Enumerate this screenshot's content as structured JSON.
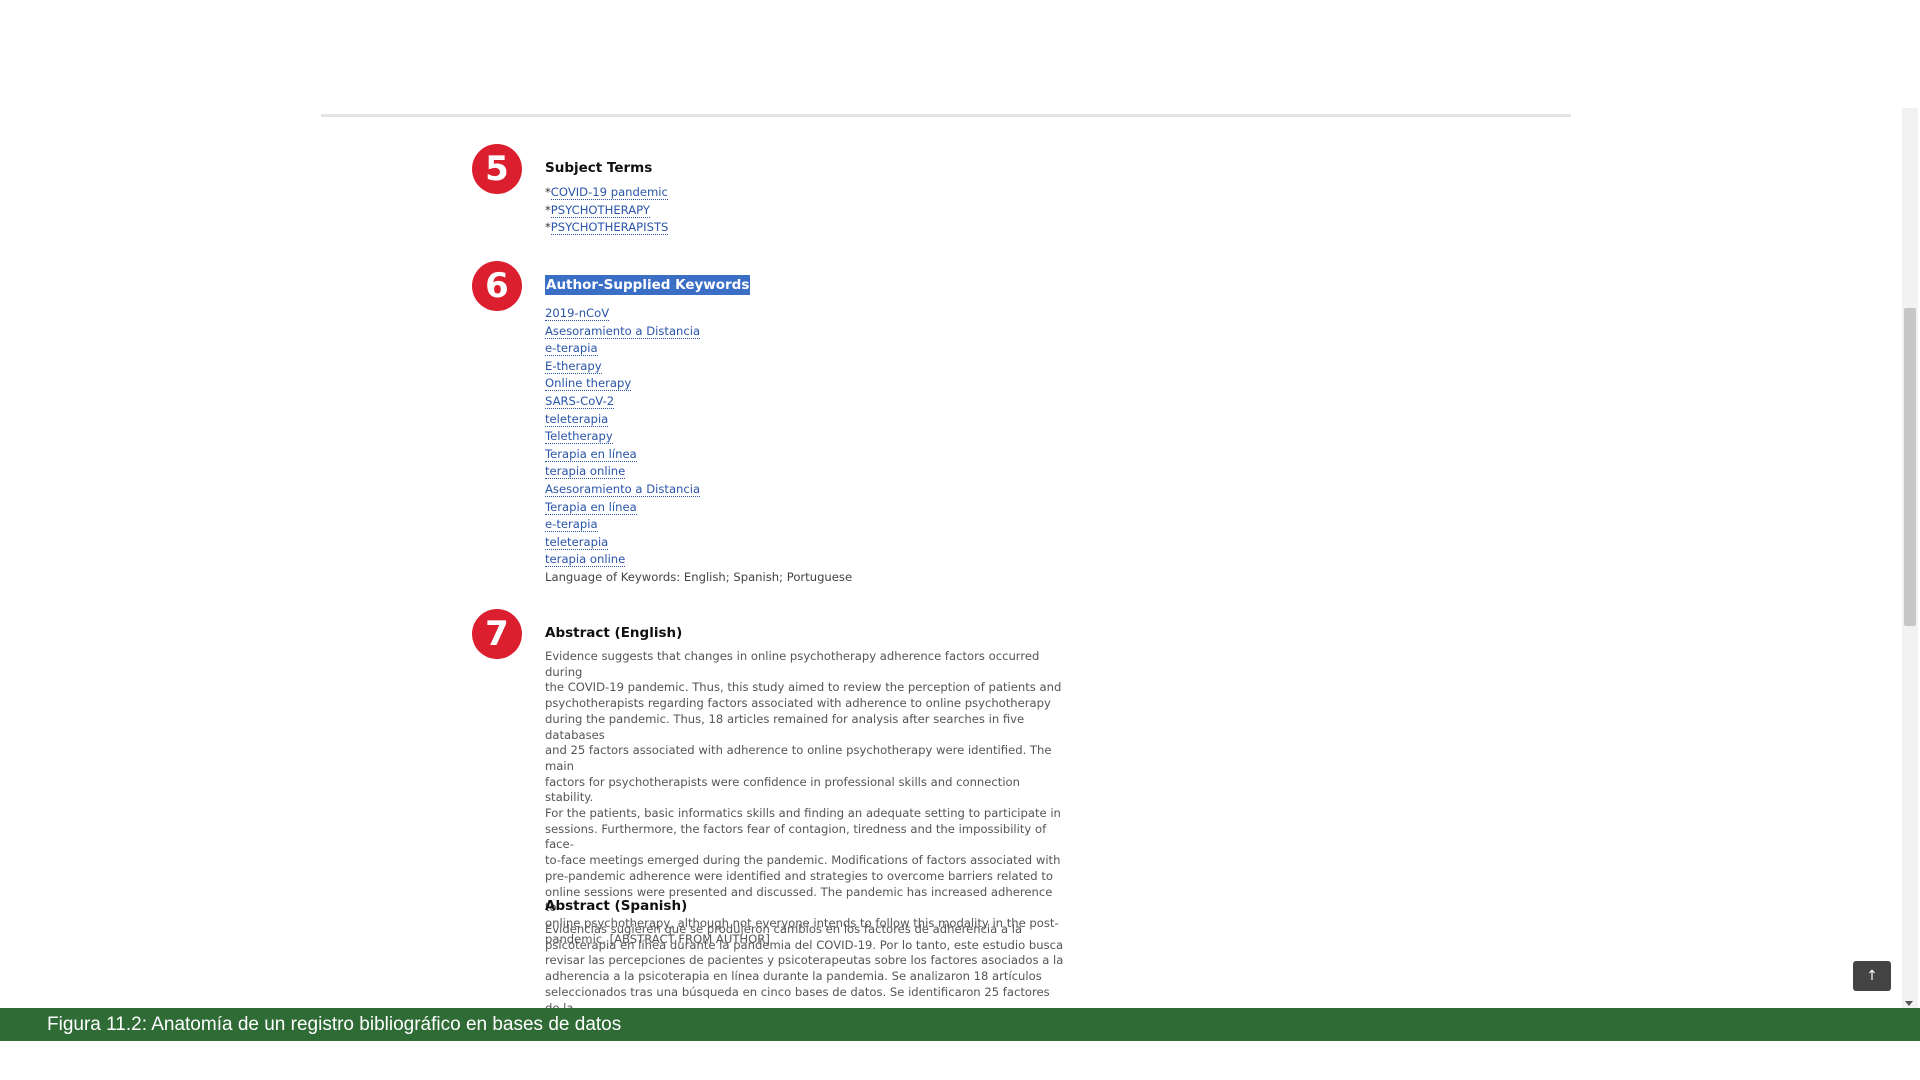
{
  "sections": {
    "subject": {
      "badge": "5",
      "heading": "Subject Terms",
      "items": [
        "COVID-19 pandemic",
        "PSYCHOTHERAPY",
        "PSYCHOTHERAPISTS"
      ],
      "prefix": "*"
    },
    "keywords": {
      "badge": "6",
      "heading": "Author-Supplied Keywords",
      "items": [
        "2019-nCoV",
        "Asesoramiento a Distancia",
        "e-terapia",
        "E-therapy",
        "Online therapy",
        "SARS-CoV-2",
        "teleterapia",
        "Teletherapy",
        "Terapia en línea",
        "terapia online",
        "Asesoramiento a Distancia",
        "Terapia en línea",
        "e-terapia",
        "teleterapia",
        "terapia online"
      ],
      "language_note": "Language of Keywords: English; Spanish; Portuguese"
    },
    "abstract_en": {
      "badge": "7",
      "heading": "Abstract (English)",
      "lines": [
        "Evidence suggests that changes in online psychotherapy adherence factors occurred during",
        "the COVID-19 pandemic. Thus, this study aimed to review the perception of patients and",
        "psychotherapists regarding factors associated with adherence to online psychotherapy",
        "during the pandemic. Thus, 18 articles remained for analysis after searches in five databases",
        "and 25 factors associated with adherence to online psychotherapy were identified. The main",
        "factors for psychotherapists were confidence in professional skills and connection stability.",
        "For the patients, basic informatics skills and finding an adequate setting to participate in",
        "sessions. Furthermore, the factors fear of contagion, tiredness and the impossibility of face-",
        "to-face meetings emerged during the pandemic. Modifications of factors associated with",
        "pre-pandemic adherence were identified and strategies to overcome barriers related to",
        "online sessions were presented and discussed. The pandemic has increased adherence to",
        "online psychotherapy, although not everyone intends to follow this modality in the post-",
        "pandemic. [ABSTRACT FROM AUTHOR]"
      ]
    },
    "abstract_es": {
      "heading": "Abstract (Spanish)",
      "lines": [
        "Evidencias sugieren que se produjeron cambios en los factores de adherencia a la",
        "psicoterapia en línea durante la pandemia del COVID-19. Por lo tanto, este estudio busca",
        "revisar las percepciones de pacientes y psicoterapeutas sobre los factores asociados a la",
        "adherencia a la psicoterapia en línea durante la pandemia. Se analizaron 18 artículos",
        "seleccionados tras una búsqueda en cinco bases de datos. Se identificaron 25 factores de la"
      ]
    }
  },
  "back_to_top_icon": "arrow-up-icon",
  "back_to_top_glyph": "↑",
  "caption": "Figura 11.2: Anatomía de un registro bibliográfico en bases de datos",
  "colors": {
    "badge": "#dc1f2e",
    "link": "#2a55a8",
    "highlight": "#3b6fc6",
    "caption_bar": "#2f6b35"
  }
}
